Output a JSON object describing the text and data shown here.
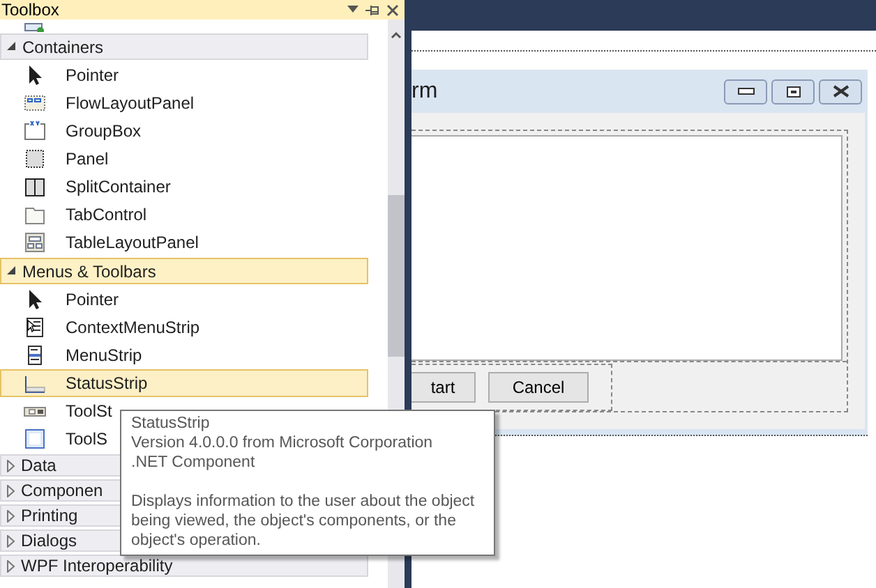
{
  "toolbox": {
    "title": "Toolbox",
    "groups": [
      {
        "label": "Containers",
        "expanded": true,
        "selected": false,
        "items": [
          {
            "label": "Pointer",
            "kind": "pointer",
            "selected": false
          },
          {
            "label": "FlowLayoutPanel",
            "kind": "flow",
            "selected": false
          },
          {
            "label": "GroupBox",
            "kind": "groupbox",
            "selected": false
          },
          {
            "label": "Panel",
            "kind": "panel",
            "selected": false
          },
          {
            "label": "SplitContainer",
            "kind": "split",
            "selected": false
          },
          {
            "label": "TabControl",
            "kind": "tab",
            "selected": false
          },
          {
            "label": "TableLayoutPanel",
            "kind": "table",
            "selected": false
          }
        ]
      },
      {
        "label": "Menus & Toolbars",
        "expanded": true,
        "selected": true,
        "items": [
          {
            "label": "Pointer",
            "kind": "pointer",
            "selected": false
          },
          {
            "label": "ContextMenuStrip",
            "kind": "contextmenu",
            "selected": false
          },
          {
            "label": "MenuStrip",
            "kind": "menu",
            "selected": false
          },
          {
            "label": "StatusStrip",
            "kind": "status",
            "selected": true
          },
          {
            "label": "ToolSt",
            "kind": "toolstrip",
            "selected": false
          },
          {
            "label": "ToolS",
            "kind": "container",
            "selected": false
          }
        ]
      },
      {
        "label": "Data",
        "expanded": false,
        "selected": false
      },
      {
        "label": "Componen",
        "expanded": false,
        "selected": false
      },
      {
        "label": "Printing",
        "expanded": false,
        "selected": false
      },
      {
        "label": "Dialogs",
        "expanded": false,
        "selected": false
      },
      {
        "label": "WPF Interoperability",
        "expanded": false,
        "selected": false
      }
    ]
  },
  "form": {
    "title": "rm",
    "buttons": [
      "tart",
      "Cancel"
    ]
  },
  "tooltip": {
    "name": "StatusStrip",
    "version": "Version 4.0.0.0 from Microsoft Corporation",
    "type": ".NET Component",
    "description": "Displays information to the user about the object being viewed, the object's components, or the object's operation."
  }
}
